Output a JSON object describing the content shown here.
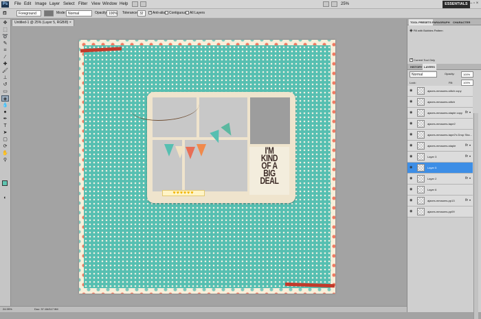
{
  "app": {
    "logo": "Ps"
  },
  "menu": [
    "File",
    "Edit",
    "Image",
    "Layer",
    "Select",
    "Filter",
    "View",
    "Window",
    "Help"
  ],
  "zoom_top": "25%",
  "essentials": "ESSENTIALS",
  "window_controls": "– ▫ ×",
  "options": {
    "tool_label": "Foreground",
    "mode_label": "Mode:",
    "mode_value": "Normal",
    "opacity_label": "Opacity:",
    "opacity_value": "100%",
    "tolerance_label": "Tolerance:",
    "tolerance_value": "32",
    "antialias": "Anti-alias",
    "contiguous": "Contiguous",
    "all_layers": "All Layers"
  },
  "document": {
    "tab": "Untitled-1 @ 25% (Layer 5, RGB/8) ×"
  },
  "canvas": {
    "big_deal": [
      "I'M",
      "KIND",
      "OF A",
      "BIG",
      "DEAL"
    ],
    "hearts": "♥♥♥♥♥♥"
  },
  "tool_presets": {
    "tabs": [
      "TOOL PRESETS",
      "PARAGRAPH",
      "CHARACTER"
    ],
    "preset": "Fill with Bubbles Pattern",
    "current_tool_only": "Current Tool Only"
  },
  "layers_panel": {
    "tabs": [
      "HISTORY",
      "LAYERS"
    ],
    "blend_mode": "Normal",
    "opacity_label": "Opacity:",
    "opacity_value": "100%",
    "lock_label": "Lock:",
    "fill_label": "Fill:",
    "fill_value": "100%",
    "layers": [
      {
        "name": "ajaxes-mmaums-stitch copy",
        "fx": ""
      },
      {
        "name": "ajaxes-mmaums-stitch",
        "fx": ""
      },
      {
        "name": "ajaxes-mmaums-staple copy",
        "fx": "fx"
      },
      {
        "name": "ajaxes-mmaums-tape2",
        "fx": ""
      },
      {
        "name": "ajaxes-mmaums-tape2's Drop Sha...",
        "fx": ""
      },
      {
        "name": "ajaxes-mmaums-staple",
        "fx": "fx"
      },
      {
        "name": "Layer 3",
        "fx": "fx"
      },
      {
        "name": "Layer 5",
        "fx": ""
      },
      {
        "name": "Layer 2",
        "fx": "fx"
      },
      {
        "name": "Layer 6",
        "fx": ""
      },
      {
        "name": "ajaxes-mmaums-pp13",
        "fx": "fx"
      },
      {
        "name": "ajaxes-mmaums-pp09",
        "fx": ""
      }
    ],
    "selected_index": 7
  },
  "status": {
    "zoom": "24.99%",
    "doc": "Doc: 37.1M/117.9M"
  },
  "colors": {
    "polka": "#56bfb1",
    "selection": "#3d8ee6",
    "frame": "#efe4cd"
  }
}
